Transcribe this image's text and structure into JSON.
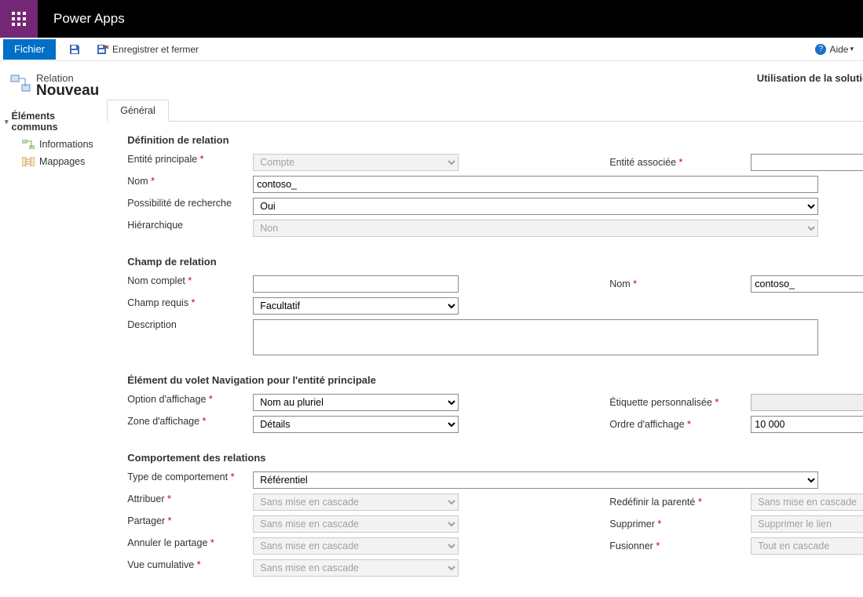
{
  "header": {
    "app_title": "Power Apps"
  },
  "cmdbar": {
    "file": "Fichier",
    "save_and_close": "Enregistrer et fermer",
    "help": "Aide"
  },
  "page": {
    "entity_type": "Relation",
    "title": "Nouveau",
    "solution_label": "Utilisation de la solution : Contoso Coffee"
  },
  "tree": {
    "root": "Éléments communs",
    "child_info": "Informations",
    "child_map": "Mappages"
  },
  "tabs": {
    "general": "Général"
  },
  "sections": {
    "definition": "Définition de relation",
    "field": "Champ de relation",
    "nav": "Élément du volet Navigation pour l'entité principale",
    "behavior": "Comportement des relations"
  },
  "labels": {
    "primary_entity": "Entité principale",
    "related_entity": "Entité associée",
    "name": "Nom",
    "searchable": "Possibilité de recherche",
    "hierarchical": "Hiérarchique",
    "display_name": "Nom complet",
    "field_name": "Nom",
    "field_req": "Champ requis",
    "description": "Description",
    "display_option": "Option d'affichage",
    "custom_label": "Étiquette personnalisée",
    "display_area": "Zone d'affichage",
    "display_order": "Ordre d'affichage",
    "behavior_type": "Type de comportement",
    "assign": "Attribuer",
    "reparent": "Redéfinir la parenté",
    "share": "Partager",
    "delete": "Supprimer",
    "unshare": "Annuler le partage",
    "merge": "Fusionner",
    "rollup": "Vue cumulative"
  },
  "values": {
    "primary_entity": "Compte",
    "related_entity": "",
    "name": "contoso_",
    "searchable": "Oui",
    "hierarchical": "Non",
    "display_name": "",
    "field_name": "contoso_",
    "field_req": "Facultatif",
    "description": "",
    "display_option": "Nom au pluriel",
    "custom_label": "",
    "display_area": "Détails",
    "display_order": "10 000",
    "behavior_type": "Référentiel",
    "cascade_none": "Sans mise en cascade",
    "delete_option": "Supprimer le lien",
    "merge_option": "Tout en cascade"
  }
}
